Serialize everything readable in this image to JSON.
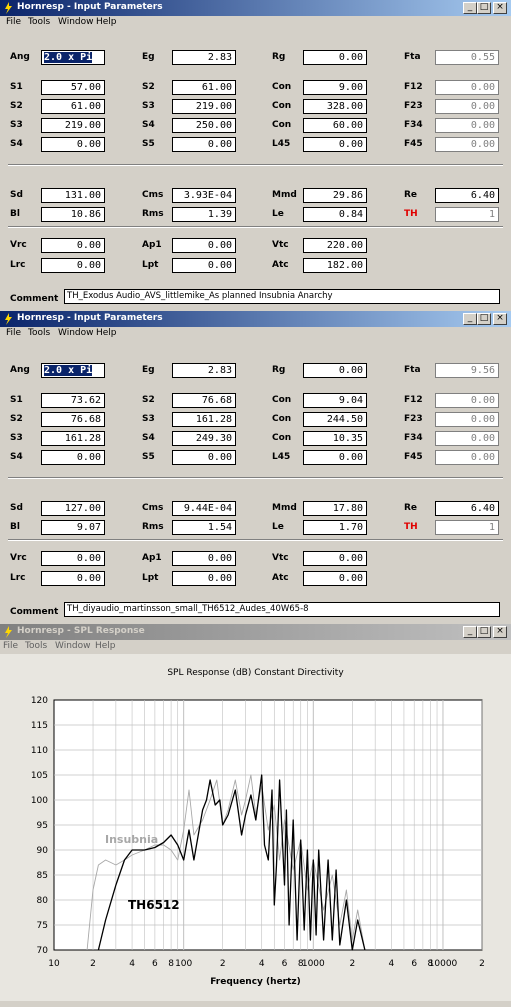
{
  "windows": [
    {
      "title": "Hornresp - Input Parameters",
      "active": true,
      "menu": [
        "File",
        "Tools",
        "Window",
        "Help"
      ],
      "params": {
        "Ang": "2.0 x Pi",
        "Eg": "2.83",
        "Rg": "0.00",
        "Fta": "0.55",
        "S1": "57.00",
        "S2a": "61.00",
        "Con1": "9.00",
        "F12": "0.00",
        "S2": "61.00",
        "S3a": "219.00",
        "Con2": "328.00",
        "F23": "0.00",
        "S3": "219.00",
        "S4a": "250.00",
        "Con3": "60.00",
        "F34": "0.00",
        "S4": "0.00",
        "S5": "0.00",
        "L45": "0.00",
        "F45": "0.00",
        "Sd": "131.00",
        "Cms": "3.93E-04",
        "Mmd": "29.86",
        "Re": "6.40",
        "Bl": "10.86",
        "Rms": "1.39",
        "Le": "0.84",
        "TH": "1",
        "Vrc": "0.00",
        "Ap1": "0.00",
        "Vtc": "220.00",
        "Lrc": "0.00",
        "Lpt": "0.00",
        "Atc": "182.00"
      },
      "comment": "TH_Exodus Audio_AVS_littlemike_As planned Insubnia Anarchy"
    },
    {
      "title": "Hornresp - Input Parameters",
      "active": true,
      "menu": [
        "File",
        "Tools",
        "Window",
        "Help"
      ],
      "params": {
        "Ang": "2.0 x Pi",
        "Eg": "2.83",
        "Rg": "0.00",
        "Fta": "9.56",
        "S1": "73.62",
        "S2a": "76.68",
        "Con1": "9.04",
        "F12": "0.00",
        "S2": "76.68",
        "S3a": "161.28",
        "Con2": "244.50",
        "F23": "0.00",
        "S3": "161.28",
        "S4a": "249.30",
        "Con3": "10.35",
        "F34": "0.00",
        "S4": "0.00",
        "S5": "0.00",
        "L45": "0.00",
        "F45": "0.00",
        "Sd": "127.00",
        "Cms": "9.44E-04",
        "Mmd": "17.80",
        "Re": "6.40",
        "Bl": "9.07",
        "Rms": "1.54",
        "Le": "1.70",
        "TH": "1",
        "Vrc": "0.00",
        "Ap1": "0.00",
        "Vtc": "0.00",
        "Lrc": "0.00",
        "Lpt": "0.00",
        "Atc": "0.00"
      },
      "comment": "TH_diyaudio_martinsson_small_TH6512_Audes_40W65-8"
    }
  ],
  "labels": {
    "Ang": "Ang",
    "Eg": "Eg",
    "Rg": "Rg",
    "Fta": "Fta",
    "S1": "S1",
    "S2": "S2",
    "S3": "S3",
    "S4": "S4",
    "S5": "S5",
    "Con": "Con",
    "L45": "L45",
    "F12": "F12",
    "F23": "F23",
    "F34": "F34",
    "F45": "F45",
    "Sd": "Sd",
    "Cms": "Cms",
    "Mmd": "Mmd",
    "Re": "Re",
    "Bl": "Bl",
    "Rms": "Rms",
    "Le": "Le",
    "TH": "TH",
    "Vrc": "Vrc",
    "Ap1": "Ap1",
    "Vtc": "Vtc",
    "Lrc": "Lrc",
    "Lpt": "Lpt",
    "Atc": "Atc",
    "Comment": "Comment"
  },
  "spl_window": {
    "title": "Hornresp - SPL Response",
    "menu": [
      "File",
      "Tools",
      "Window",
      "Help"
    ],
    "colors": {
      "insubnia": "#a8a8a8",
      "th6512": "#000000",
      "grid": "#c0c0c0"
    }
  },
  "chart_data": {
    "type": "line",
    "title": "SPL Response (dB)   Constant Directivity",
    "xlabel": "Frequency (hertz)",
    "xscale": "log",
    "xlim": [
      10,
      20000
    ],
    "ylim": [
      70,
      120
    ],
    "yticks": [
      70,
      75,
      80,
      85,
      90,
      95,
      100,
      105,
      110,
      115,
      120
    ],
    "xtick_labels": [
      {
        "f": 10,
        "t": "10"
      },
      {
        "f": 20,
        "t": "2"
      },
      {
        "f": 40,
        "t": "4"
      },
      {
        "f": 60,
        "t": "6"
      },
      {
        "f": 80,
        "t": "8"
      },
      {
        "f": 100,
        "t": "100"
      },
      {
        "f": 200,
        "t": "2"
      },
      {
        "f": 400,
        "t": "4"
      },
      {
        "f": 600,
        "t": "6"
      },
      {
        "f": 800,
        "t": "8"
      },
      {
        "f": 1000,
        "t": "1000"
      },
      {
        "f": 2000,
        "t": "2"
      },
      {
        "f": 4000,
        "t": "4"
      },
      {
        "f": 6000,
        "t": "6"
      },
      {
        "f": 8000,
        "t": "8"
      },
      {
        "f": 10000,
        "t": "10000"
      },
      {
        "f": 20000,
        "t": "2"
      }
    ],
    "series": [
      {
        "name": "Insubnia",
        "points": [
          [
            18,
            70
          ],
          [
            20,
            82
          ],
          [
            22,
            87
          ],
          [
            25,
            88
          ],
          [
            30,
            87
          ],
          [
            35,
            88
          ],
          [
            40,
            89
          ],
          [
            50,
            90
          ],
          [
            60,
            91
          ],
          [
            70,
            91
          ],
          [
            80,
            90
          ],
          [
            90,
            88
          ],
          [
            100,
            94
          ],
          [
            110,
            102
          ],
          [
            120,
            93
          ],
          [
            140,
            96
          ],
          [
            160,
            100
          ],
          [
            180,
            104
          ],
          [
            200,
            95
          ],
          [
            220,
            98
          ],
          [
            250,
            104
          ],
          [
            280,
            97
          ],
          [
            300,
            100
          ],
          [
            330,
            105
          ],
          [
            360,
            97
          ],
          [
            400,
            103
          ],
          [
            450,
            94
          ],
          [
            500,
            99
          ],
          [
            550,
            88
          ],
          [
            600,
            96
          ],
          [
            700,
            86
          ],
          [
            800,
            92
          ],
          [
            900,
            82
          ],
          [
            1000,
            88
          ],
          [
            1200,
            78
          ],
          [
            1400,
            85
          ],
          [
            1600,
            75
          ],
          [
            1800,
            82
          ],
          [
            2000,
            72
          ],
          [
            2200,
            78
          ],
          [
            2500,
            70
          ]
        ]
      },
      {
        "name": "TH6512",
        "points": [
          [
            22,
            70
          ],
          [
            25,
            76
          ],
          [
            30,
            83
          ],
          [
            35,
            88
          ],
          [
            40,
            90
          ],
          [
            50,
            90
          ],
          [
            60,
            90.5
          ],
          [
            70,
            91.5
          ],
          [
            80,
            93
          ],
          [
            90,
            91
          ],
          [
            100,
            88
          ],
          [
            110,
            94
          ],
          [
            120,
            88
          ],
          [
            140,
            98
          ],
          [
            150,
            100
          ],
          [
            160,
            104
          ],
          [
            175,
            99
          ],
          [
            190,
            100
          ],
          [
            200,
            95
          ],
          [
            220,
            97
          ],
          [
            250,
            102
          ],
          [
            280,
            93
          ],
          [
            300,
            97
          ],
          [
            330,
            101
          ],
          [
            360,
            96
          ],
          [
            400,
            105
          ],
          [
            420,
            91
          ],
          [
            450,
            88
          ],
          [
            480,
            102
          ],
          [
            500,
            79
          ],
          [
            520,
            87
          ],
          [
            550,
            104
          ],
          [
            600,
            83
          ],
          [
            620,
            98
          ],
          [
            650,
            75
          ],
          [
            700,
            96
          ],
          [
            750,
            72
          ],
          [
            800,
            92
          ],
          [
            850,
            74
          ],
          [
            900,
            90
          ],
          [
            950,
            72
          ],
          [
            1000,
            88
          ],
          [
            1050,
            73
          ],
          [
            1100,
            90
          ],
          [
            1200,
            72
          ],
          [
            1300,
            88
          ],
          [
            1400,
            72
          ],
          [
            1500,
            86
          ],
          [
            1600,
            71
          ],
          [
            1800,
            80
          ],
          [
            2000,
            70
          ],
          [
            2200,
            76
          ],
          [
            2500,
            70
          ]
        ]
      }
    ],
    "annotations": [
      "Insubnia",
      "TH6512"
    ]
  }
}
